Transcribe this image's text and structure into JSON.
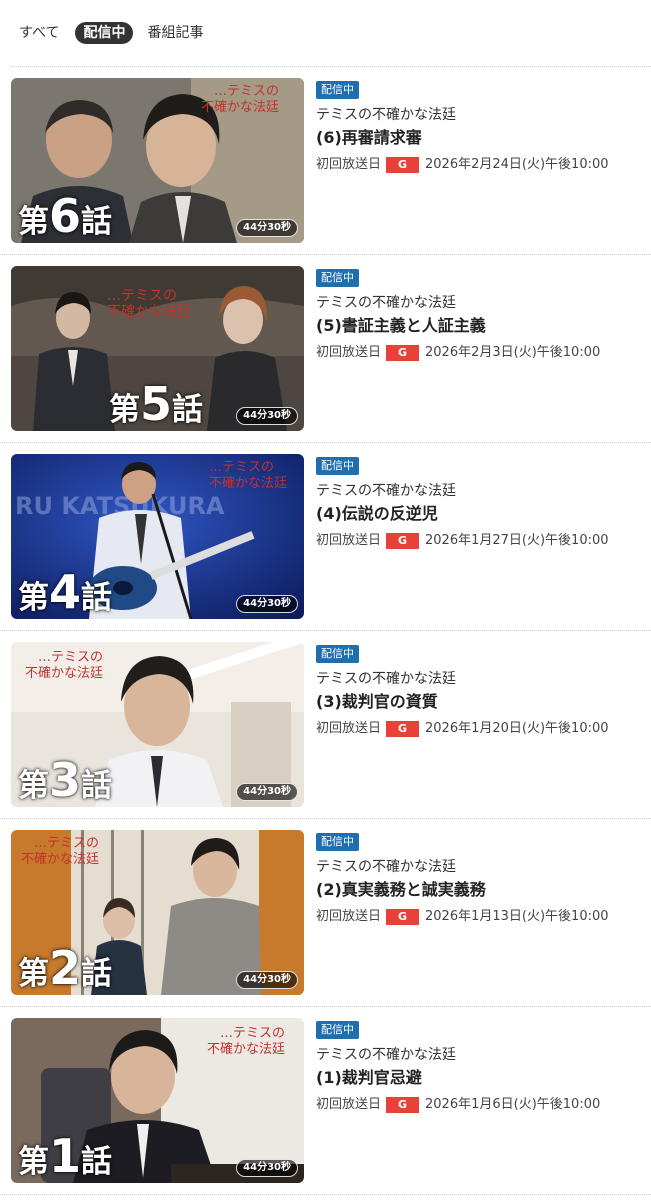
{
  "tabs": [
    {
      "label": "すべて",
      "active": false
    },
    {
      "label": "配信中",
      "active": true
    },
    {
      "label": "番組記事",
      "active": false
    }
  ],
  "episodes": [
    {
      "episode_prefix": "第",
      "episode_number": "6",
      "episode_suffix": "話",
      "duration": "44分30秒",
      "badge": "配信中",
      "series": "テミスの不確かな法廷",
      "title": "(6)再審請求審",
      "air_label": "初回放送日",
      "channel": "G",
      "air_date": "2026年2月24日(火)午後10:00",
      "logo_text": "テミスの\n不確かな法廷"
    },
    {
      "episode_prefix": "第",
      "episode_number": "5",
      "episode_suffix": "話",
      "duration": "44分30秒",
      "badge": "配信中",
      "series": "テミスの不確かな法廷",
      "title": "(5)書証主義と人証主義",
      "air_label": "初回放送日",
      "channel": "G",
      "air_date": "2026年2月3日(火)午後10:00",
      "logo_text": "テミスの\n不確かな法廷"
    },
    {
      "episode_prefix": "第",
      "episode_number": "4",
      "episode_suffix": "話",
      "duration": "44分30秒",
      "badge": "配信中",
      "series": "テミスの不確かな法廷",
      "title": "(4)伝説の反逆児",
      "air_label": "初回放送日",
      "channel": "G",
      "air_date": "2026年1月27日(火)午後10:00",
      "logo_text": "テミスの\n不確かな法廷"
    },
    {
      "episode_prefix": "第",
      "episode_number": "3",
      "episode_suffix": "話",
      "duration": "44分30秒",
      "badge": "配信中",
      "series": "テミスの不確かな法廷",
      "title": "(3)裁判官の資質",
      "air_label": "初回放送日",
      "channel": "G",
      "air_date": "2026年1月20日(火)午後10:00",
      "logo_text": "テミスの\n不確かな法廷"
    },
    {
      "episode_prefix": "第",
      "episode_number": "2",
      "episode_suffix": "話",
      "duration": "44分30秒",
      "badge": "配信中",
      "series": "テミスの不確かな法廷",
      "title": "(2)真実義務と誠実義務",
      "air_label": "初回放送日",
      "channel": "G",
      "air_date": "2026年1月13日(火)午後10:00",
      "logo_text": "テミスの\n不確かな法廷"
    },
    {
      "episode_prefix": "第",
      "episode_number": "1",
      "episode_suffix": "話",
      "duration": "44分30秒",
      "badge": "配信中",
      "series": "テミスの不確かな法廷",
      "title": "(1)裁判官忌避",
      "air_label": "初回放送日",
      "channel": "G",
      "air_date": "2026年1月6日(火)午後10:00",
      "logo_text": "テミスの\n不確かな法廷"
    }
  ],
  "colors": {
    "badge_blue": "#1f6fb0",
    "channel_red": "#e8413a",
    "active_tab": "#333333"
  }
}
